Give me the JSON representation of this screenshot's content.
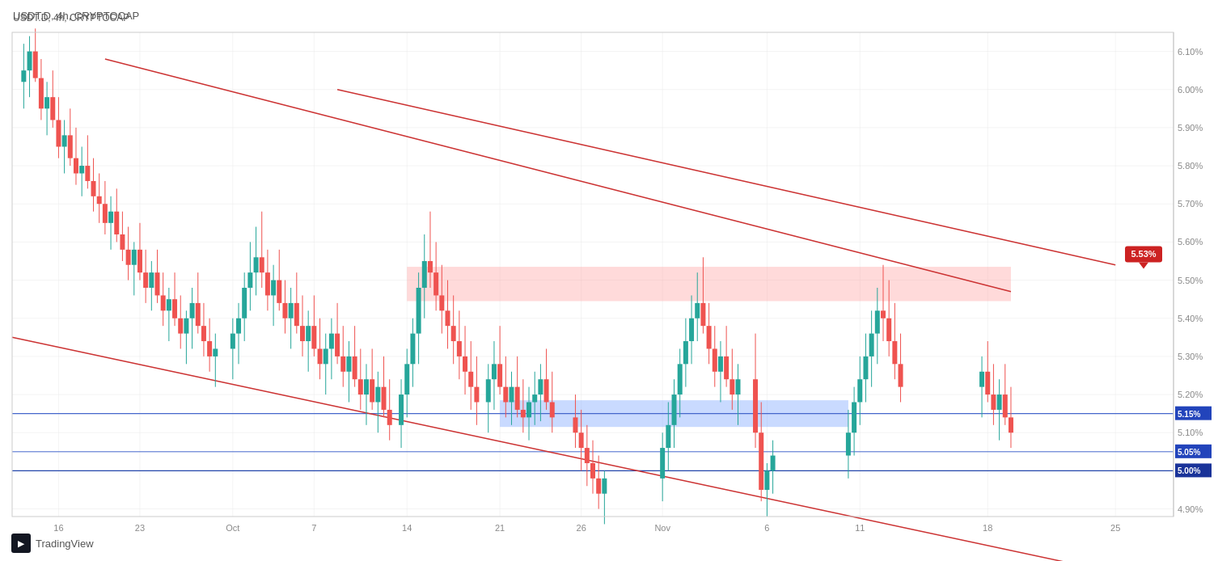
{
  "header": {
    "symbol": "USDT.D, 4h, CRYPTOCAP"
  },
  "chart": {
    "bg_color": "#ffffff",
    "grid_color": "#f0f0f0",
    "axis_color": "#cccccc",
    "text_color": "#555555"
  },
  "price_levels": {
    "max": 6.1,
    "min": 4.9,
    "labels": [
      "6.10%",
      "6.00%",
      "5.90%",
      "5.80%",
      "5.70%",
      "5.60%",
      "5.50%",
      "5.40%",
      "5.30%",
      "5.20%",
      "5.10%",
      "5.00%",
      "4.90%"
    ]
  },
  "time_labels": [
    "16",
    "23",
    "Oct",
    "7",
    "14",
    "21",
    "26",
    "Nov",
    "6",
    "11",
    "18",
    "25"
  ],
  "annotations": {
    "price_553": "5.53%",
    "price_515": "5.15%",
    "price_505": "5.05%",
    "price_500": "5.00%"
  },
  "logo": {
    "icon_text": "TV",
    "brand_name": "TradingView"
  }
}
